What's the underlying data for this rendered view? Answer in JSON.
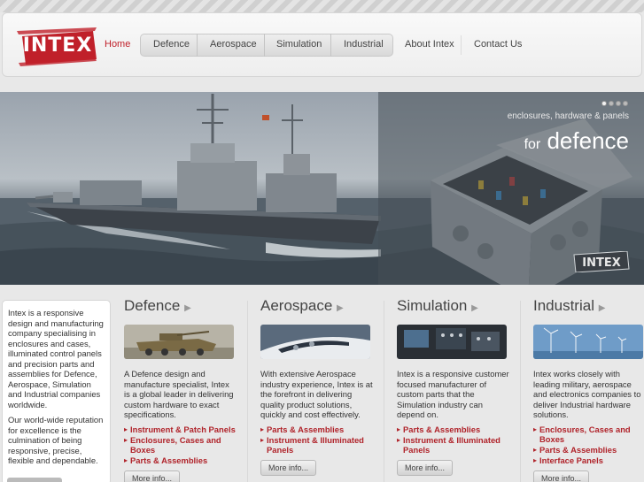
{
  "brand": {
    "logo_text": "INTEX",
    "accent": "#c0202a"
  },
  "nav": {
    "home": "Home",
    "items": [
      "Defence",
      "Aerospace",
      "Simulation",
      "Industrial"
    ],
    "about": "About Intex",
    "contact": "Contact Us"
  },
  "hero": {
    "tagline": "enclosures, hardware & panels",
    "for_word": "for",
    "headline": "defence",
    "badge_text": "INTEX",
    "dots": 4,
    "active_dot": 1
  },
  "intro": {
    "p1": "Intex is a responsive design and manufacturing company specialising in enclosures and cases, illuminated control panels and precision parts and assemblies for Defence, Aerospace, Simulation and Industrial companies worldwide.",
    "p2": "Our world-wide reputation for excellence is the culmination of being responsive, precise, flexible and dependable."
  },
  "columns": [
    {
      "title": "Defence",
      "image_icon": "armored-vehicle-image",
      "description": "A Defence design and manufacture specialist, Intex is a global leader in delivering custom hardware to exact specifications.",
      "links": [
        "Instrument & Patch Panels",
        "Enclosures, Cases and Boxes",
        "Parts & Assemblies"
      ],
      "button": "More info..."
    },
    {
      "title": "Aerospace",
      "image_icon": "jet-cockpit-image",
      "description": "With extensive Aerospace industry experience, Intex is at the forefront in delivering quality product solutions, quickly and cost effectively.",
      "links": [
        "Parts & Assemblies",
        "Instrument & Illuminated Panels"
      ],
      "button": "More info..."
    },
    {
      "title": "Simulation",
      "image_icon": "simulator-console-image",
      "description": "Intex is a responsive customer focused manufacturer of custom parts that the Simulation industry can depend on.",
      "links": [
        "Parts & Assemblies",
        "Instrument & Illuminated Panels"
      ],
      "button": "More info..."
    },
    {
      "title": "Industrial",
      "image_icon": "wind-turbines-image",
      "description": "Intex works closely with leading military, aerospace and electronics companies to deliver Industrial hardware solutions.",
      "links": [
        "Enclosures, Cases and Boxes",
        "Parts & Assemblies",
        "Interface Panels"
      ],
      "button": "More info..."
    }
  ]
}
